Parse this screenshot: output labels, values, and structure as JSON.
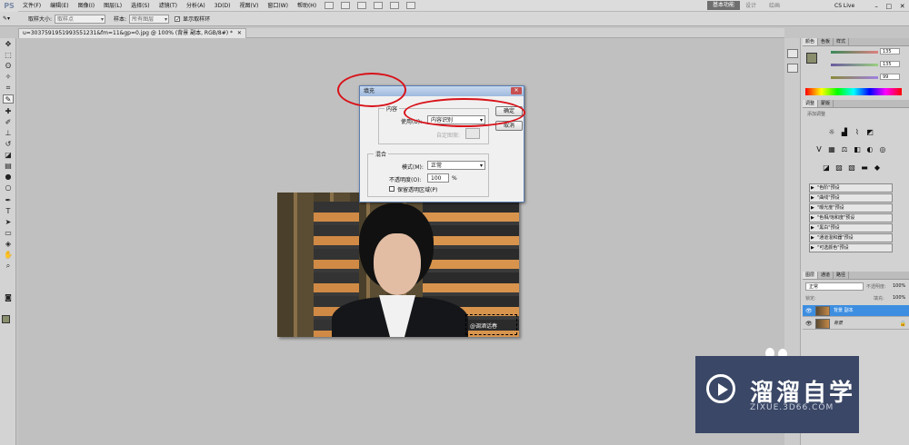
{
  "app": {
    "logo": "PS"
  },
  "menu": [
    "文件(F)",
    "编辑(E)",
    "图像(I)",
    "图层(L)",
    "选择(S)",
    "滤镜(T)",
    "分析(A)",
    "3D(D)",
    "视图(V)",
    "窗口(W)",
    "帮助(H)"
  ],
  "workspace": {
    "active": "基本功能",
    "other1": "设计",
    "other2": "绘画",
    "cslive": "CS Live"
  },
  "options": {
    "sample_size_label": "取样大小:",
    "sample_size_value": "取样点",
    "sample_label": "样本:",
    "sample_value": "所有图层",
    "show_ring_label": "显示取样环",
    "show_ring_checked": true
  },
  "document": {
    "tab": "u=3037591951993551231&fm=11&gp=0.jpg @ 100% (背景 副本, RGB/8#) *",
    "close": "✕"
  },
  "watermark": "@调酒话春",
  "dialog": {
    "title": "填充",
    "close": "✕",
    "content_legend": "内容",
    "use_label": "使用(U):",
    "use_value": "内容识别",
    "custom_pattern": "自定图案:",
    "blend_legend": "混合",
    "mode_label": "模式(M):",
    "mode_value": "正常",
    "opacity_label": "不透明度(O):",
    "opacity_value": "100",
    "opacity_unit": "%",
    "preserve_label": "保留透明区域(P)",
    "ok": "确定",
    "cancel": "取消"
  },
  "panels": {
    "color_tabs": [
      "颜色",
      "色板",
      "样式"
    ],
    "values": [
      "135",
      "135",
      "99"
    ],
    "adjust_tabs": [
      "调整",
      "蒙版"
    ],
    "adjust_title": "添加调整",
    "presets": [
      "\"色阶\"预设",
      "\"曲线\"预设",
      "\"曝光度\"预设",
      "\"色相/饱和度\"预设",
      "\"黑白\"预设",
      "\"通道混和器\"预设",
      "\"可选颜色\"预设"
    ],
    "layer_tabs": [
      "图层",
      "通道",
      "路径"
    ],
    "layer_mode": "正常",
    "opacity_label": "不透明度:",
    "opacity_value": "100%",
    "lock_label": "锁定:",
    "fill_label": "填充:",
    "fill_value": "100%",
    "layers": [
      "背景 副本",
      "背景"
    ]
  },
  "logo": {
    "cn": "溜溜自学",
    "en": "ZIXUE.3D66.COM"
  },
  "colors": {
    "accent": "#3a4766",
    "annotation": "#d8121a",
    "selected_layer": "#3d8ee0"
  }
}
